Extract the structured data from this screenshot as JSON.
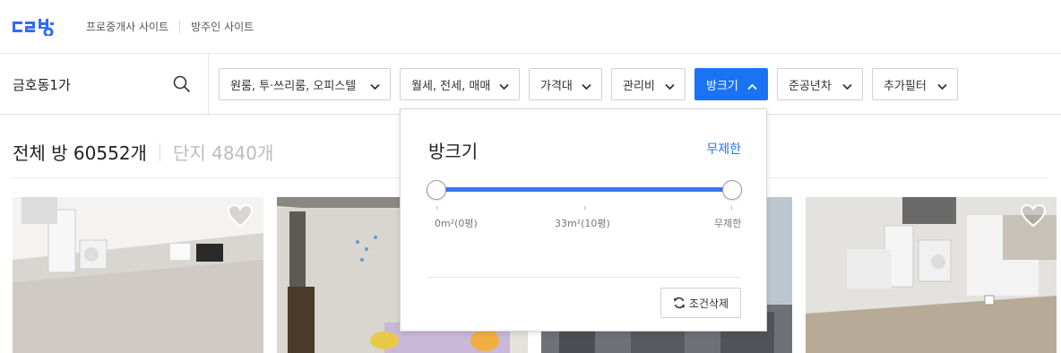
{
  "header": {
    "logo_alt": "다방",
    "links": [
      "프로중개사 사이트",
      "방주인 사이트"
    ]
  },
  "search": {
    "value": "금호동1가"
  },
  "filters": [
    {
      "label": "원룸, 투·쓰리룸, 오피스텔",
      "active": false
    },
    {
      "label": "월세, 전세, 매매",
      "active": false
    },
    {
      "label": "가격대",
      "active": false
    },
    {
      "label": "관리비",
      "active": false
    },
    {
      "label": "방크기",
      "active": true
    },
    {
      "label": "준공년차",
      "active": false
    },
    {
      "label": "추가필터",
      "active": false
    }
  ],
  "counts": {
    "rooms": "전체 방 60552개",
    "complexes": "단지 4840개"
  },
  "panel": {
    "title": "방크기",
    "value": "무제한",
    "slider": {
      "min_fraction": 0.0,
      "max_fraction": 1.0
    },
    "ticks": [
      "0m²(0평)",
      "33m²(10평)",
      "무제한"
    ],
    "reset_label": "조건삭제"
  },
  "colors": {
    "accent": "#1a73f5",
    "brand": "#326cf9"
  },
  "icons": {
    "search": "search-icon",
    "chevron": "chevron-down-icon",
    "chevron_up": "chevron-up-icon",
    "heart": "heart-icon",
    "refresh": "refresh-icon"
  }
}
